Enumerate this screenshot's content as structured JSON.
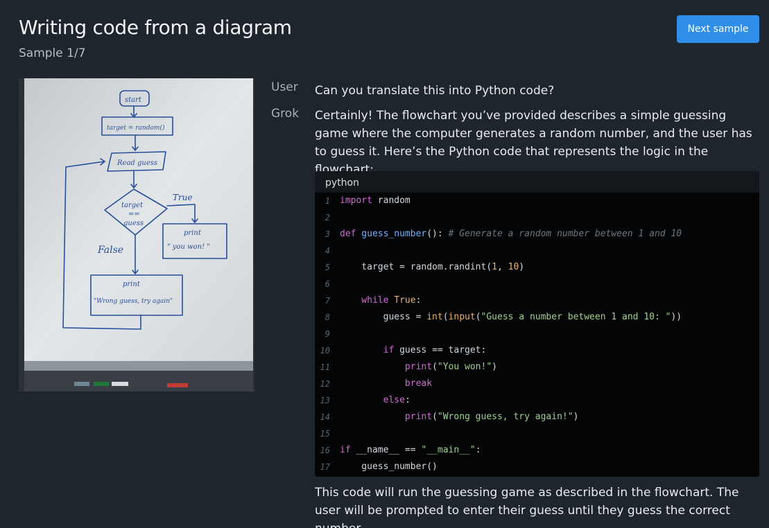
{
  "header": {
    "title": "Writing code from a diagram",
    "subtitle": "Sample 1/7",
    "next_label": "Next sample"
  },
  "whiteboard": {
    "start": "start",
    "target": "target = random()",
    "read": "Read guess",
    "cond_top": "target",
    "cond_mid": "==",
    "cond_bot": "guess",
    "true_label": "True",
    "false_label": "False",
    "print_won_1": "print",
    "print_won_2": "\" you won! \"",
    "print_wrong_1": "print",
    "print_wrong_2": "\"Wrong guess, try again\""
  },
  "chat": {
    "user_label": "User",
    "user_message": "Can you translate this into Python code?",
    "bot_label": "Grok",
    "bot_intro": "Certainly! The flowchart you’ve provided describes a simple guessing game where the computer generates a random number, and the user has to guess it. Here’s the Python code that represents the logic in the flowchart:",
    "code_language": "python",
    "bot_outro": "This code will run the guessing game as described in the flowchart. The user will be prompted to enter their guess until they guess the correct number."
  },
  "code_lines": [
    {
      "n": "1"
    },
    {
      "n": "2"
    },
    {
      "n": "3"
    },
    {
      "n": "4"
    },
    {
      "n": "5"
    },
    {
      "n": "6"
    },
    {
      "n": "7"
    },
    {
      "n": "8"
    },
    {
      "n": "9"
    },
    {
      "n": "10"
    },
    {
      "n": "11"
    },
    {
      "n": "12"
    },
    {
      "n": "13"
    },
    {
      "n": "14"
    },
    {
      "n": "15"
    },
    {
      "n": "16"
    },
    {
      "n": "17"
    }
  ],
  "code_tokens": {
    "import": "import",
    "random": " random",
    "def": "def",
    "guess_number": " guess_number",
    "paren_colon": "(): ",
    "comment": "# Generate a random number between 1 and 10",
    "target_assign": "    target = random.randint(",
    "one": "1",
    "comma": ", ",
    "ten": "10",
    "close": ")",
    "while": "    while",
    "true": " True",
    "colon": ":",
    "guess_assign": "        guess = ",
    "int": "int",
    "open": "(",
    "input": "input",
    "prompt": "\"Guess a number between 1 and 10: \"",
    "close2": "))",
    "if1": "        if",
    "cond": " guess == target:",
    "indent12": "            ",
    "print": "print",
    "won": "\"You won!\"",
    "break": "break",
    "indent8": "        ",
    "else": "else",
    "wrong": "\"Wrong guess, try again!\"",
    "if2": "if",
    "name_cmp": " __name__ == ",
    "main": "\"__main__\"",
    "call": "    guess_number()"
  }
}
